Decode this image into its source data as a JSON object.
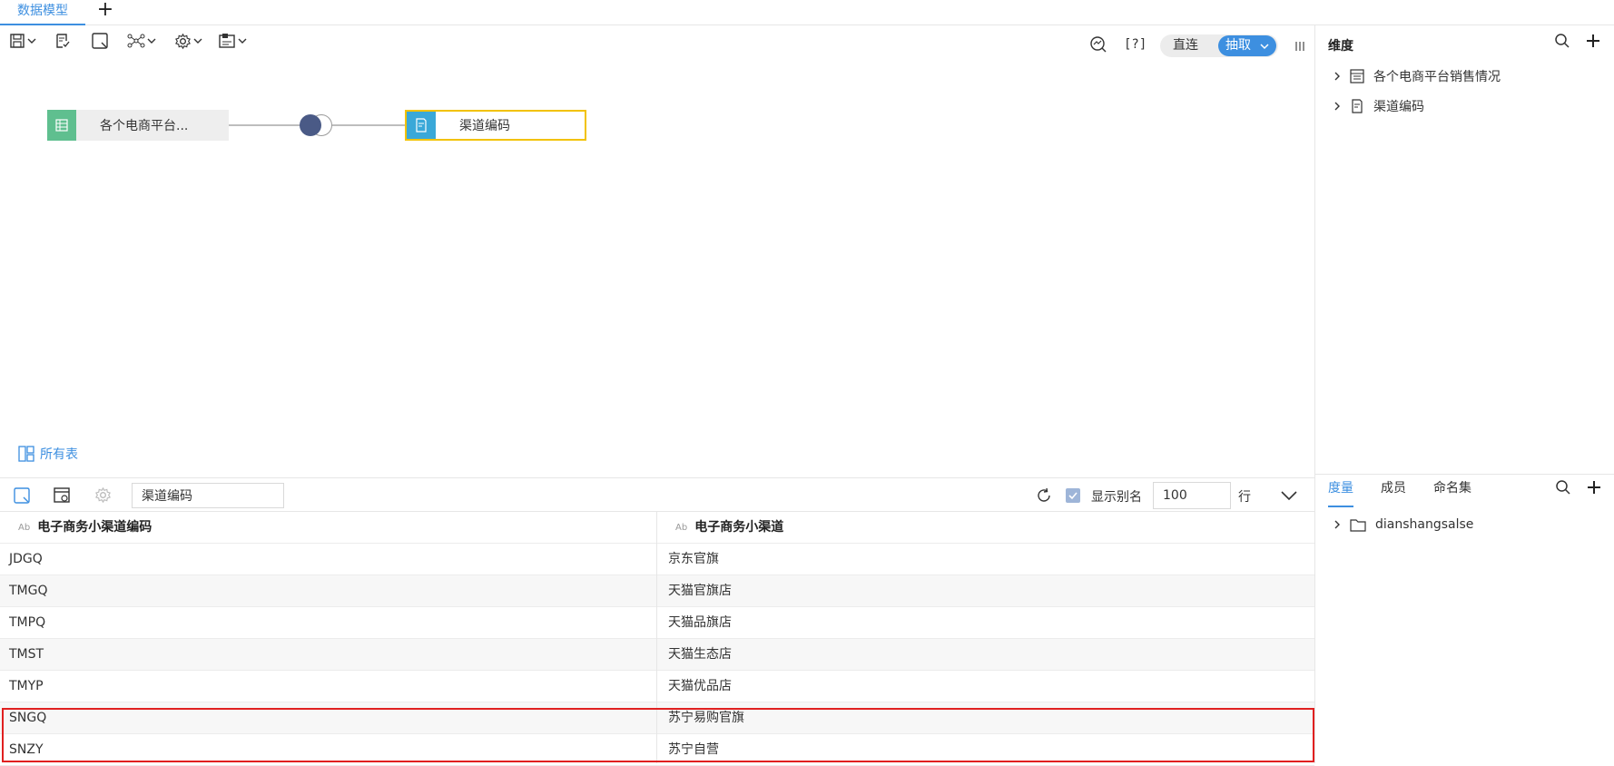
{
  "tabs": {
    "active": "数据模型",
    "add": "+"
  },
  "toolbar": {
    "help": "[?]",
    "mode_direct": "直连",
    "mode_extract": "抽取",
    "icons": [
      "save-icon",
      "check-doc-icon",
      "preview-icon",
      "network-icon",
      "settings-icon",
      "export-icon",
      "zoom-icon",
      "help-icon",
      "column-icon"
    ]
  },
  "canvas": {
    "left_node": "各个电商平台...",
    "right_node": "渠道编码",
    "all_tables": "所有表"
  },
  "bottom_toolbar": {
    "search_value": "渠道编码",
    "show_alias": "显示别名",
    "rows_value": "100",
    "rows_unit": "行"
  },
  "table": {
    "columns": [
      "电子商务小渠道编码",
      "电子商务小渠道"
    ],
    "type_icon": "Ab",
    "rows": [
      [
        "JDGQ",
        "京东官旗"
      ],
      [
        "TMGQ",
        "天猫官旗店"
      ],
      [
        "TMPQ",
        "天猫品旗店"
      ],
      [
        "TMST",
        "天猫生态店"
      ],
      [
        "TMYP",
        "天猫优品店"
      ],
      [
        "SNGQ",
        "苏宁易购官旗"
      ],
      [
        "SNZY",
        "苏宁自营"
      ]
    ]
  },
  "right_panel": {
    "dimension_title": "维度",
    "dimension_items": [
      "各个电商平台销售情况",
      "渠道编码"
    ],
    "tabs": [
      "度量",
      "成员",
      "命名集"
    ],
    "active_tab": "度量",
    "measure_items": [
      "dianshangsalse"
    ]
  },
  "colors": {
    "accent": "#3d8fe0",
    "highlight": "#e02020",
    "node_green": "#5fbf8f",
    "node_blue": "#3aa8d8",
    "node_border": "#f2c200"
  }
}
